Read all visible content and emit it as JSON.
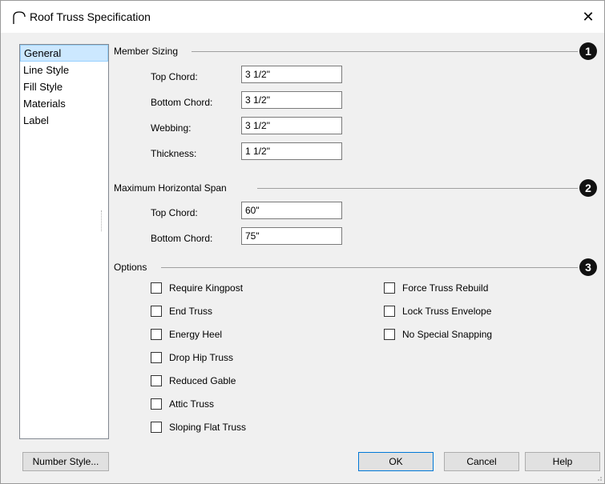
{
  "window": {
    "title": "Roof Truss Specification",
    "close_glyph": "✕",
    "icon": "roof-truss-icon"
  },
  "tabs": [
    {
      "label": "General",
      "selected": true
    },
    {
      "label": "Line Style"
    },
    {
      "label": "Fill Style"
    },
    {
      "label": "Materials"
    },
    {
      "label": "Label"
    }
  ],
  "member_sizing": {
    "title": "Member Sizing",
    "callout": "1",
    "top_chord_label": "Top Chord:",
    "top_chord_value": "3 1/2\"",
    "bottom_chord_label": "Bottom Chord:",
    "bottom_chord_value": "3 1/2\"",
    "webbing_label": "Webbing:",
    "webbing_value": "3 1/2\"",
    "thickness_label": "Thickness:",
    "thickness_value": "1 1/2\""
  },
  "max_span": {
    "title": "Maximum Horizontal Span",
    "callout": "2",
    "top_chord_label": "Top Chord:",
    "top_chord_value": "60\"",
    "bottom_chord_label": "Bottom Chord:",
    "bottom_chord_value": "75\""
  },
  "options": {
    "title": "Options",
    "callout": "3",
    "left": [
      "Require Kingpost",
      "End Truss",
      "Energy Heel",
      "Drop Hip Truss",
      "Reduced Gable",
      "Attic Truss",
      "Sloping Flat Truss"
    ],
    "right": [
      "Force Truss Rebuild",
      "Lock Truss Envelope",
      "No Special Snapping"
    ]
  },
  "buttons": {
    "number_style": "Number Style...",
    "ok": "OK",
    "cancel": "Cancel",
    "help": "Help"
  }
}
